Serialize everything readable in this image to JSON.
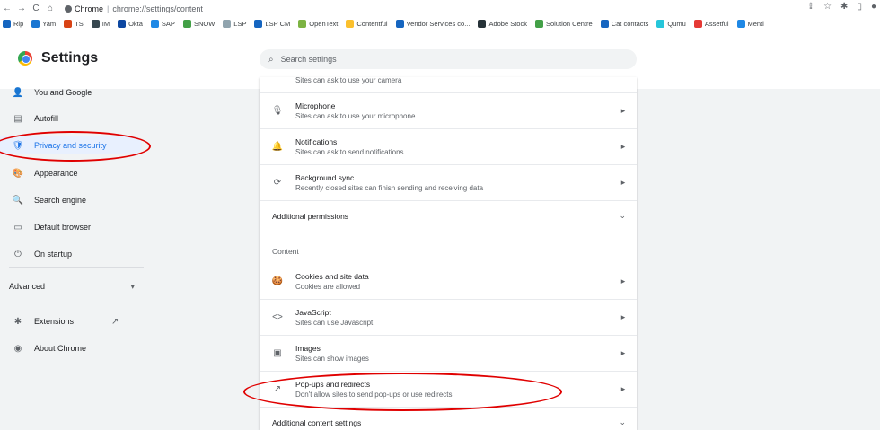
{
  "toolbar": {
    "back": "←",
    "forward": "→",
    "reload": "C",
    "home": "⌂",
    "site_label": "Chrome",
    "url": "chrome://settings/content"
  },
  "bookmarks": [
    {
      "label": "Rip",
      "color": "#1565c0"
    },
    {
      "label": "Yam",
      "color": "#1976d2"
    },
    {
      "label": "TS",
      "color": "#d84315"
    },
    {
      "label": "IM",
      "color": "#37474f"
    },
    {
      "label": "Okta",
      "color": "#0d47a1"
    },
    {
      "label": "SAP",
      "color": "#1e88e5"
    },
    {
      "label": "SNOW",
      "color": "#43a047"
    },
    {
      "label": "LSP",
      "color": "#90a4ae"
    },
    {
      "label": "LSP CM",
      "color": "#1565c0"
    },
    {
      "label": "OpenText",
      "color": "#7cb342"
    },
    {
      "label": "Contentful",
      "color": "#fbc02d"
    },
    {
      "label": "Vendor Services co...",
      "color": "#1565c0"
    },
    {
      "label": "Adobe Stock",
      "color": "#263238"
    },
    {
      "label": "Solution Centre",
      "color": "#43a047"
    },
    {
      "label": "Cat contacts",
      "color": "#1565c0"
    },
    {
      "label": "Qumu",
      "color": "#26c6da"
    },
    {
      "label": "Assetful",
      "color": "#e53935"
    },
    {
      "label": "Menti",
      "color": "#1e88e5"
    }
  ],
  "header": {
    "title": "Settings",
    "search_placeholder": "Search settings"
  },
  "sidebar": {
    "items": [
      {
        "label": "You and Google",
        "icon": "👤"
      },
      {
        "label": "Autofill",
        "icon": "▤"
      },
      {
        "label": "Privacy and security",
        "icon": "🛡"
      },
      {
        "label": "Appearance",
        "icon": "🎨"
      },
      {
        "label": "Search engine",
        "icon": "🔍"
      },
      {
        "label": "Default browser",
        "icon": "▭"
      },
      {
        "label": "On startup",
        "icon": "⏻"
      }
    ],
    "advanced_label": "Advanced",
    "advanced_chevron": "▾",
    "extensions_label": "Extensions",
    "extensions_icon": "✱",
    "external_icon": "↗",
    "about_label": "About Chrome",
    "about_icon": "◉"
  },
  "content": {
    "camera_sub": "Sites can ask to use your camera",
    "rows": [
      {
        "title": "Microphone",
        "sub": "Sites can ask to use your microphone",
        "icon": "🎙"
      },
      {
        "title": "Notifications",
        "sub": "Sites can ask to send notifications",
        "icon": "🔔"
      },
      {
        "title": "Background sync",
        "sub": "Recently closed sites can finish sending and receiving data",
        "icon": "⟳"
      }
    ],
    "additional_permissions": "Additional permissions",
    "content_heading": "Content",
    "content_rows": [
      {
        "title": "Cookies and site data",
        "sub": "Cookies are allowed",
        "icon": "🍪"
      },
      {
        "title": "JavaScript",
        "sub": "Sites can use Javascript",
        "icon": "<>"
      },
      {
        "title": "Images",
        "sub": "Sites can show images",
        "icon": "▣"
      },
      {
        "title": "Pop-ups and redirects",
        "sub": "Don't allow sites to send pop-ups or use redirects",
        "icon": "↗"
      }
    ],
    "additional_content": "Additional content settings",
    "arrow": "▸",
    "chevron": "⌄"
  }
}
